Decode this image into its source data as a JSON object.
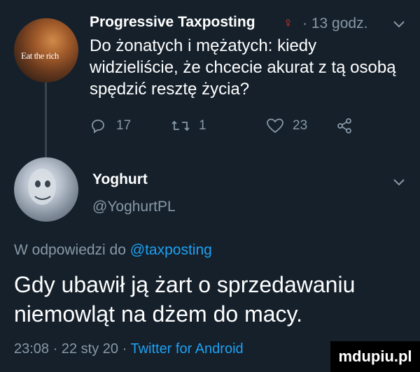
{
  "tweet1": {
    "author_name": "Progressive Taxposting",
    "badge_icon": "woman-symbol-icon",
    "separator": "·",
    "time": "13 godz.",
    "avatar_text": "Eat the rich",
    "text": "Do żonatych i mężatych: kiedy widzieliście, że chcecie akurat z tą osobą spędzić resztę życia?",
    "replies": "17",
    "retweets": "1",
    "likes": "23"
  },
  "tweet2": {
    "author_name": "Yoghurt",
    "handle": "@YoghurtPL",
    "reply_prefix": "W odpowiedzi do",
    "reply_mention": "@taxposting",
    "text": "Gdy ubawił ją żart o sprzedawaniu niemowląt na dżem do macy.",
    "time": "23:08",
    "date": "22 sty 20",
    "source": "Twitter for Android",
    "separator": "·"
  },
  "watermark": "mdupiu.pl",
  "colors": {
    "background": "#15202b",
    "secondary_text": "#8899a6",
    "link": "#1da1f2"
  }
}
